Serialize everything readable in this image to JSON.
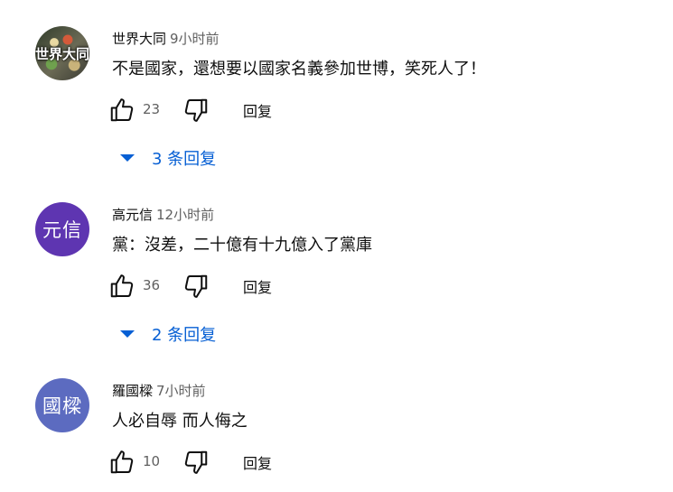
{
  "comments": [
    {
      "avatar_text": "世界大同",
      "avatar_color": "#4a5a3a",
      "author": "世界大同",
      "time": "9小时前",
      "text": "不是國家，還想要以國家名義參加世博，笑死人了！",
      "likes": "23",
      "reply_label": "回复",
      "replies_label": "3 条回复"
    },
    {
      "avatar_text": "元信",
      "avatar_color": "#5e35b1",
      "author": "高元信",
      "time": "12小时前",
      "text": "黨：沒差，二十億有十九億入了黨庫",
      "likes": "36",
      "reply_label": "回复",
      "replies_label": "2 条回复"
    },
    {
      "avatar_text": "國樑",
      "avatar_color": "#5c6bc0",
      "author": "羅國樑",
      "time": "7小时前",
      "text": "人必自辱 而人侮之",
      "likes": "10",
      "reply_label": "回复"
    }
  ],
  "icons": {
    "like": "thumb-up-icon",
    "dislike": "thumb-down-icon",
    "expand": "triangle-down-icon"
  },
  "colors": {
    "link_blue": "#065fd4",
    "secondary_text": "#606060"
  }
}
